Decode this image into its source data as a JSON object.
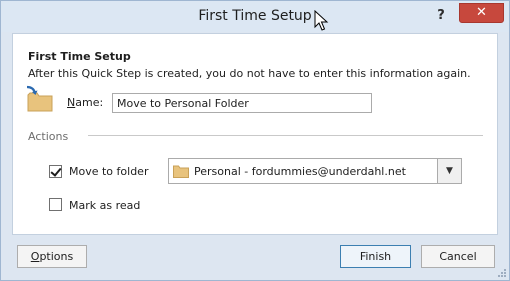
{
  "window": {
    "title": "First Time Setup",
    "help_label": "?",
    "close_label": "✕"
  },
  "panel": {
    "heading": "First Time Setup",
    "description": "After this Quick Step is created, you do not have to enter this information again.",
    "name_label": "Name:",
    "name_value": "Move to Personal Folder",
    "section_label": "Actions",
    "move_to_folder": {
      "label": "Move to folder",
      "checked": true
    },
    "folder_select": {
      "value": "Personal - fordummies@underdahl.net",
      "arrow": "▼"
    },
    "mark_as_read": {
      "label": "Mark as read",
      "checked": false
    }
  },
  "buttons": {
    "options": "Options",
    "finish": "Finish",
    "cancel": "Cancel"
  },
  "colors": {
    "title_bg": "#dce7f3",
    "close_bg": "#c7483d",
    "folder": "#e8c37d",
    "accent": "#3c7fb1"
  }
}
